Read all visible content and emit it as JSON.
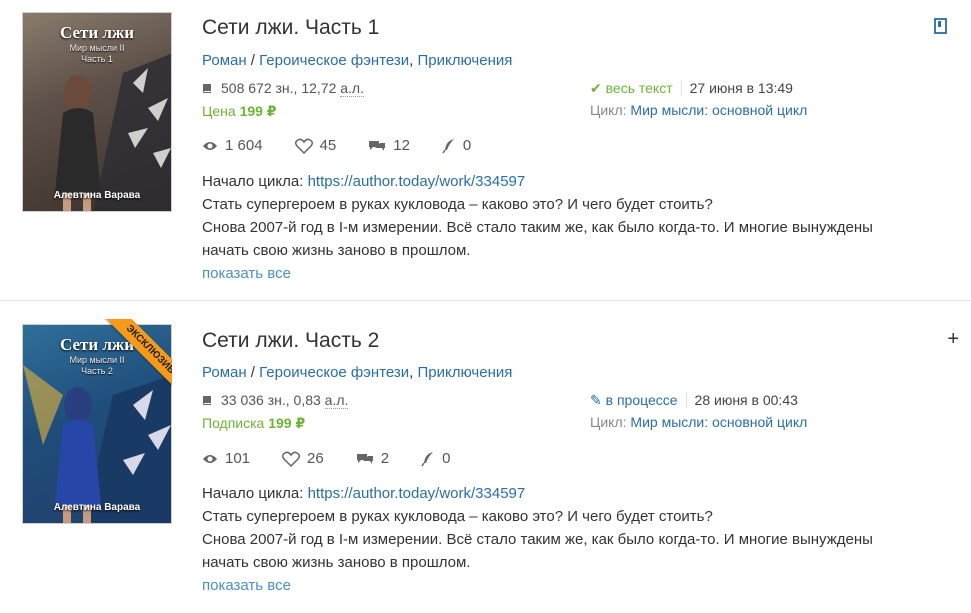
{
  "books": [
    {
      "title": "Сети лжи. Часть 1",
      "cover": {
        "title": "Сети лжи",
        "subtitle_1": "Мир мысли II",
        "subtitle_2": "Часть 1",
        "author": "Алевтина Варава"
      },
      "genre_1": "Роман",
      "genre_sep": " / ",
      "genre_2": "Героическое фэнтези",
      "genre_comma": ", ",
      "genre_3": "Приключения",
      "size_chars": "508 672 зн., 12,72",
      "size_unit": "а.л.",
      "price_label": "Цена",
      "price_value": "199 ₽",
      "status": "весь текст",
      "date": "27 июня в 13:49",
      "cycle_label": "Цикл:",
      "cycle_name": "Мир мысли: основной цикл",
      "views": "1 604",
      "likes": "45",
      "comments": "12",
      "rewards": "0",
      "desc_prefix": "Начало цикла:",
      "desc_link": "https://author.today/work/334597",
      "desc_line_1": "Стать супергероем в руках кукловода – каково это? И чего будет стоить?",
      "desc_line_2": "Снова 2007-й год в I-м измерении. Всё стало таким же, как было когда-то. И многие вынуждены",
      "desc_line_3": "начать свою жизнь заново в прошлом.",
      "show_all": "показать все",
      "action_icon": "bookmark-icon"
    },
    {
      "title": "Сети лжи. Часть 2",
      "cover": {
        "title": "Сети лжи",
        "subtitle_1": "Мир мысли II",
        "subtitle_2": "Часть 2",
        "author": "Алевтина Варава",
        "ribbon": "ЭКСКЛЮЗИВ"
      },
      "genre_1": "Роман",
      "genre_sep": " / ",
      "genre_2": "Героическое фэнтези",
      "genre_comma": ", ",
      "genre_3": "Приключения",
      "size_chars": "33 036 зн., 0,83",
      "size_unit": "а.л.",
      "price_label": "Подписка",
      "price_value": "199 ₽",
      "status": "в процессе",
      "date": "28 июня в 00:43",
      "cycle_label": "Цикл:",
      "cycle_name": "Мир мысли: основной цикл",
      "views": "101",
      "likes": "26",
      "comments": "2",
      "rewards": "0",
      "desc_prefix": "Начало цикла:",
      "desc_link": "https://author.today/work/334597",
      "desc_line_1": "Стать супергероем в руках кукловода – каково это? И чего будет стоить?",
      "desc_line_2": "Снова 2007-й год в I-м измерении. Всё стало таким же, как было когда-то. И многие вынуждены",
      "desc_line_3": "начать свою жизнь заново в прошлом.",
      "show_all": "показать все",
      "action_icon": "plus-icon",
      "action_text": "+"
    }
  ],
  "colors": {
    "link": "#2a6ea6",
    "green": "#6fb336",
    "ribbon": "#f59a1b"
  }
}
